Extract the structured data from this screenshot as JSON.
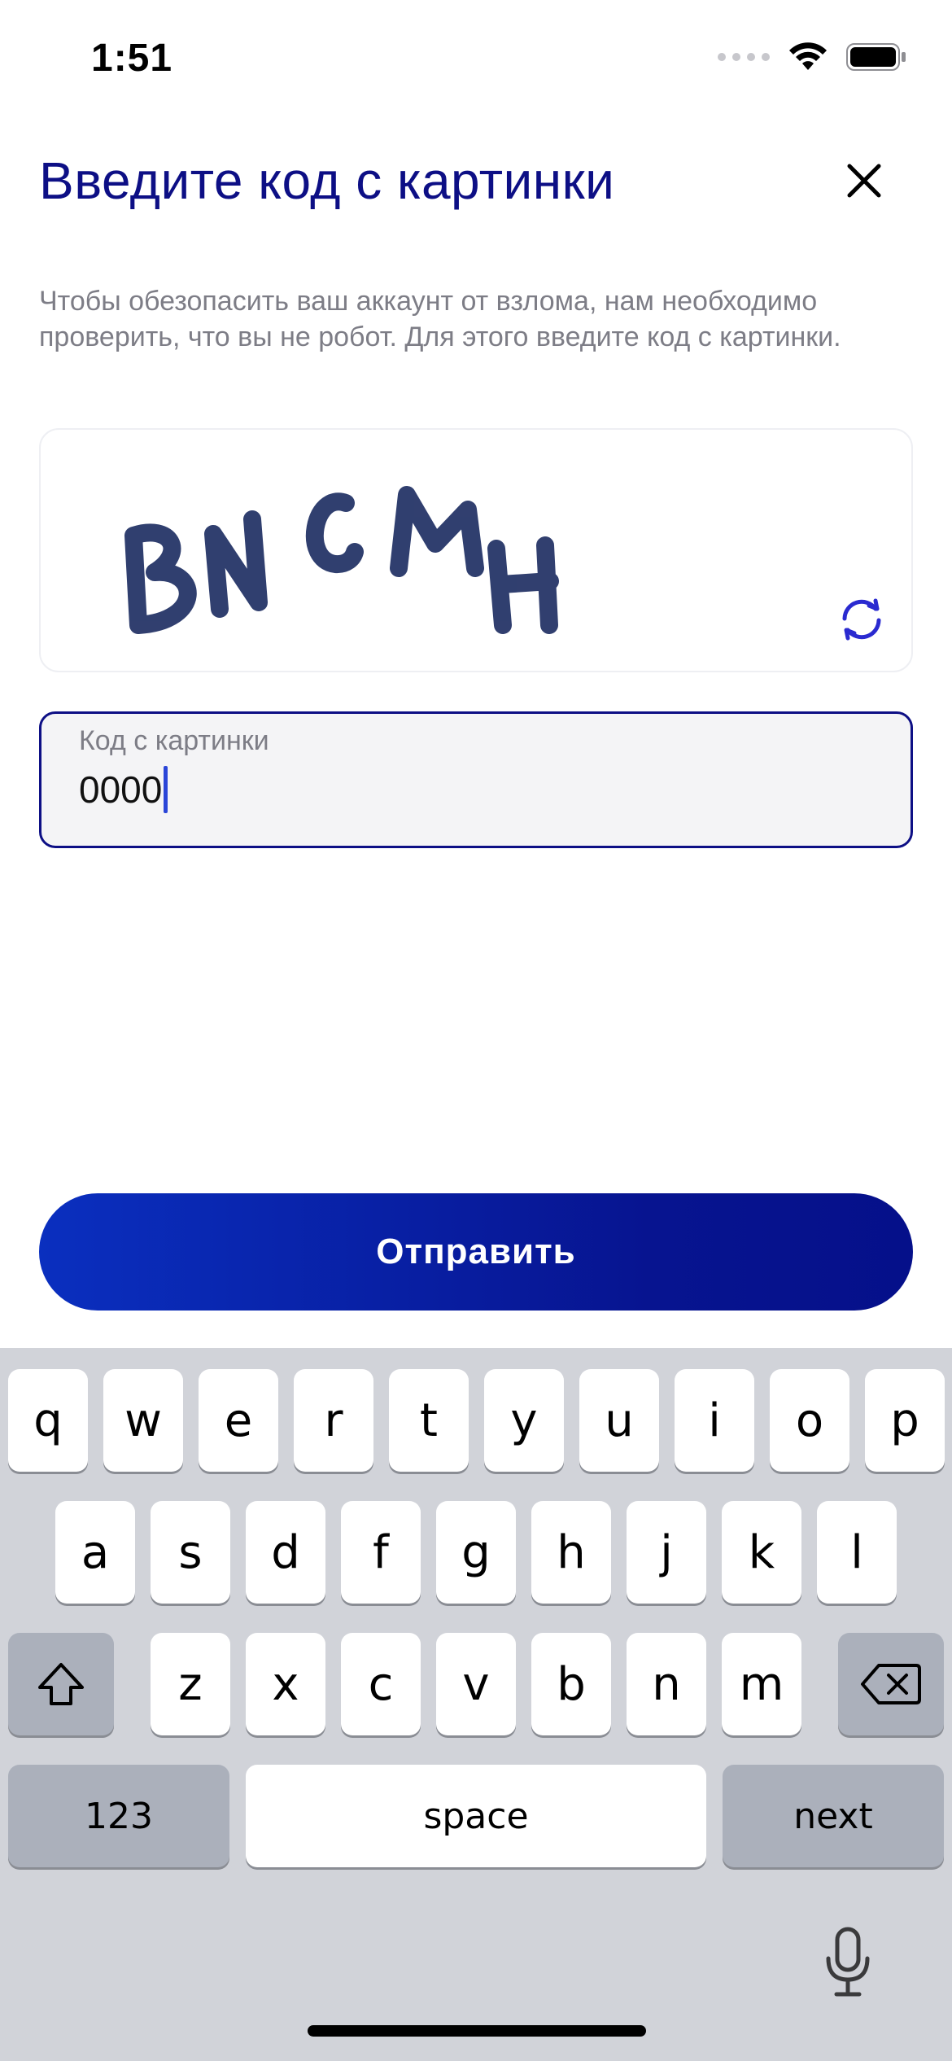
{
  "status_bar": {
    "time": "1:51"
  },
  "header": {
    "title": "Введите код с картинки",
    "description": "Чтобы обезопасить ваш аккаунт от взлома, нам необходимо проверить, что вы не робот. Для этого введите код с картинки."
  },
  "captcha": {
    "text": "BNCMH"
  },
  "input": {
    "label": "Код с картинки",
    "value": "0000"
  },
  "submit": {
    "label": "Отправить"
  },
  "keyboard": {
    "row1": [
      "q",
      "w",
      "e",
      "r",
      "t",
      "y",
      "u",
      "i",
      "o",
      "p"
    ],
    "row2": [
      "a",
      "s",
      "d",
      "f",
      "g",
      "h",
      "j",
      "k",
      "l"
    ],
    "row3": [
      "z",
      "x",
      "c",
      "v",
      "b",
      "n",
      "m"
    ],
    "numbers_label": "123",
    "space_label": "space",
    "next_label": "next"
  },
  "colors": {
    "accent": "#0d0f85",
    "button_start": "#0a2fbf",
    "button_end": "#05108a"
  }
}
